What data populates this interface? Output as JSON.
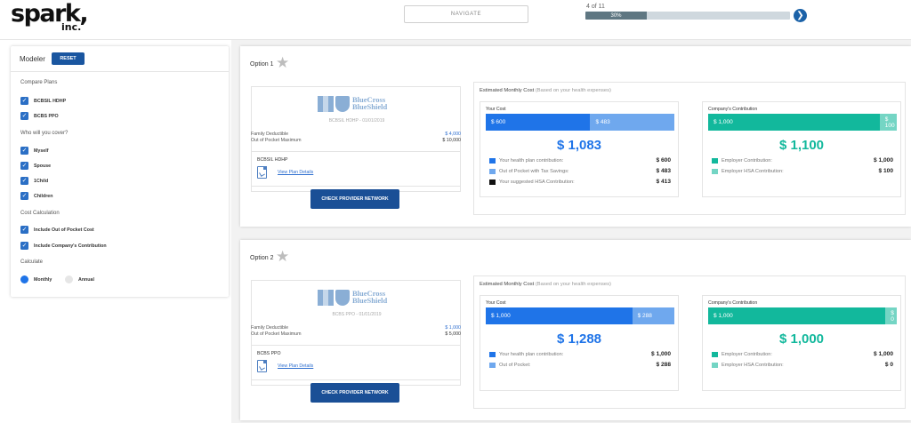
{
  "header": {
    "logo_word": "spark,",
    "logo_sub": "inc.",
    "navigate_label": "NAVIGATE",
    "step_text": "4 of 11",
    "progress_label": "30%",
    "progress_fraction": 0.3,
    "next_icon": "chevron-right-icon"
  },
  "sidebar": {
    "title": "Modeler",
    "reset_label": "RESET",
    "compare_heading": "Compare Plans",
    "plans": [
      "BCBSIL HDHP",
      "BCBS PPO"
    ],
    "cover_heading": "Who will you cover?",
    "cover": [
      "Myself",
      "Spouse",
      "1Child",
      "Children"
    ],
    "cost_heading": "Cost Calculation",
    "cost": [
      "Include Out of Pocket Cost",
      "Include Company's Contribution"
    ],
    "calc_heading": "Calculate",
    "calc_options": [
      "Monthly",
      "Annual"
    ],
    "calc_selected": "Monthly"
  },
  "options": [
    {
      "title": "Option 1",
      "insurer_line1": "BlueCross",
      "insurer_line2": "BlueShield",
      "plan_caption": "BCBSIL HDHP - 01/01/2019",
      "deductible_label": "Family Deductible",
      "deductible_value": "$ 4,000",
      "oop_label": "Out of Pocket Maximum",
      "oop_value": "$ 10,000",
      "plan_name": "BCBSIL HDHP",
      "details_link": "View Plan Details",
      "network_button": "CHECK PROVIDER NETWORK",
      "estimate_title": "Estimated Monthly Cost",
      "estimate_note": "(Based on your health expenses)",
      "your_cost": {
        "title": "Your Cost",
        "bar": [
          {
            "label": "$ 600",
            "value": 600,
            "color": "#1f74e8"
          },
          {
            "label": "$ 483",
            "value": 483,
            "color": "#6fa8ee"
          }
        ],
        "total": "$ 1,083",
        "items": [
          {
            "label": "Your health plan contribution:",
            "value": "$ 600",
            "color": "#1f74e8"
          },
          {
            "label": "Out of Pocket with Tax Savings:",
            "value": "$ 483",
            "color": "#6fa8ee"
          },
          {
            "label": "Your suggested HSA Contribution:",
            "value": "$ 413",
            "color": "#111111"
          }
        ]
      },
      "company": {
        "title": "Company's Contribution",
        "bar": [
          {
            "label": "$ 1,000",
            "value": 1000,
            "color": "#12b89c"
          },
          {
            "label": "$ 100",
            "value": 100,
            "color": "#74d5c4"
          }
        ],
        "total": "$ 1,100",
        "items": [
          {
            "label": "Employer Contribution:",
            "value": "$ 1,000",
            "color": "#12b89c"
          },
          {
            "label": "Employer HSA Contribution:",
            "value": "$ 100",
            "color": "#74d5c4"
          }
        ]
      }
    },
    {
      "title": "Option 2",
      "insurer_line1": "BlueCross",
      "insurer_line2": "BlueShield",
      "plan_caption": "BCBS PPO - 01/01/2019",
      "deductible_label": "Family Deductible",
      "deductible_value": "$ 1,000",
      "oop_label": "Out of Pocket Maximum",
      "oop_value": "$ 5,000",
      "plan_name": "BCBS PPO",
      "details_link": "View Plan Details",
      "network_button": "CHECK PROVIDER NETWORK",
      "estimate_title": "Estimated Monthly Cost",
      "estimate_note": "(Based on your health expenses)",
      "your_cost": {
        "title": "Your Cost",
        "bar": [
          {
            "label": "$ 1,000",
            "value": 1000,
            "color": "#1f74e8"
          },
          {
            "label": "$ 288",
            "value": 288,
            "color": "#6fa8ee"
          }
        ],
        "total": "$ 1,288",
        "items": [
          {
            "label": "Your health plan contribution:",
            "value": "$ 1,000",
            "color": "#1f74e8"
          },
          {
            "label": "Out of Pocket:",
            "value": "$ 288",
            "color": "#6fa8ee"
          }
        ]
      },
      "company": {
        "title": "Company's Contribution",
        "bar": [
          {
            "label": "$ 1,000",
            "value": 1000,
            "color": "#12b89c"
          },
          {
            "label": "$ 0",
            "value": 0,
            "color": "#74d5c4"
          }
        ],
        "total": "$ 1,000",
        "items": [
          {
            "label": "Employer Contribution:",
            "value": "$ 1,000",
            "color": "#12b89c"
          },
          {
            "label": "Employer HSA Contribution:",
            "value": "$ 0",
            "color": "#74d5c4"
          }
        ]
      }
    }
  ]
}
